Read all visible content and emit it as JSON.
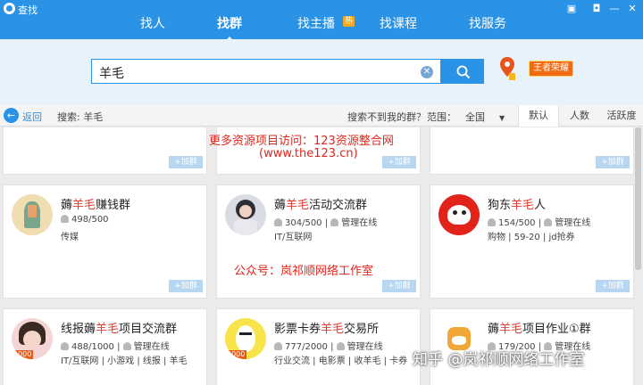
{
  "window": {
    "title": "查找"
  },
  "tabs": [
    {
      "label": "找人"
    },
    {
      "label": "找群"
    },
    {
      "label": "找主播",
      "badge": "热"
    },
    {
      "label": "找课程"
    },
    {
      "label": "找服务"
    }
  ],
  "search": {
    "value": "羊毛",
    "king_badge": "王者荣耀"
  },
  "filter": {
    "back_label": "返回",
    "search_label": "搜索: 羊毛",
    "not_found": "搜索不到我的群？",
    "range_label": "范围：",
    "range_value": "全国",
    "sorts": [
      "默认",
      "人数",
      "活跃度"
    ]
  },
  "add_label": "+加群",
  "cards": [
    {
      "name_pre": "薅",
      "name_hl": "羊毛",
      "name_post": "赚钱群",
      "members": "498/500",
      "admin": "",
      "tags": "传媒"
    },
    {
      "name_pre": "薅",
      "name_hl": "羊毛",
      "name_post": "活动交流群",
      "members": "304/500",
      "admin": "管理在线",
      "tags": "IT/互联网"
    },
    {
      "name_pre": "狗东",
      "name_hl": "羊毛",
      "name_post": "人",
      "members": "154/500",
      "admin": "管理在线",
      "tags": "购物 | 59-20 | jd抢券"
    },
    {
      "name_pre": "线报薅",
      "name_hl": "羊毛",
      "name_post": "项目交流群",
      "members": "488/1000",
      "admin": "管理在线",
      "tags": "IT/互联网 | 小游戏 | 线报 | 羊毛",
      "level": "1000"
    },
    {
      "name_pre": "影票卡券",
      "name_hl": "羊毛",
      "name_post": "交易所",
      "members": "777/2000",
      "admin": "管理在线",
      "tags": "行业交流 | 电影票 | 收羊毛 | 卡券",
      "level": "2000"
    },
    {
      "name_pre": "薅",
      "name_hl": "羊毛",
      "name_post": "项目作业①群",
      "members": "179/200",
      "admin": "管理在线",
      "tags": ""
    }
  ],
  "overlay": {
    "line1": "更多资源项目访问：123资源整合网",
    "line2": "(www.the123.cn)",
    "line3": "公众号：岚祁顺网络工作室",
    "watermark": "知乎 @岚祁顺网络工作室"
  },
  "colors": {
    "accent": "#2a93e6",
    "highlight": "#e03c31"
  }
}
